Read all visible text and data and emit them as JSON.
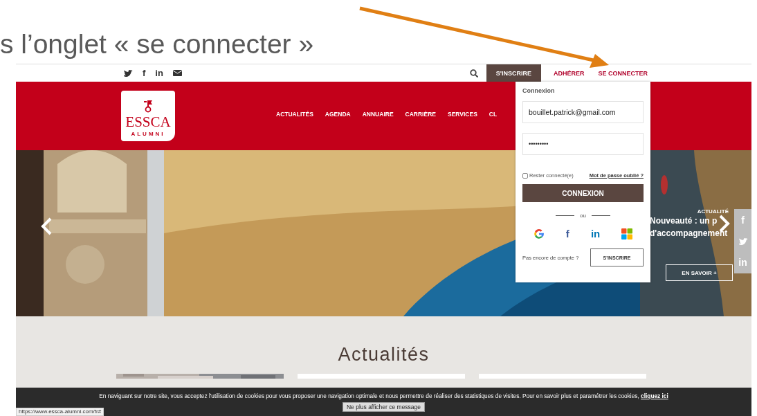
{
  "slide": {
    "caption": "s l’onglet « se connecter »"
  },
  "site": {
    "social_links": [
      {
        "kind": "twitter"
      },
      {
        "kind": "glyph",
        "glyph": "f"
      },
      {
        "kind": "glyph",
        "glyph": "in"
      },
      {
        "kind": "mail"
      }
    ],
    "top_links": [
      {
        "label": "S'INSCRIRE",
        "kind": "filled"
      },
      {
        "label": "ADHÉRER",
        "kind": "plain"
      },
      {
        "label": "SE CONNECTER",
        "kind": "plain"
      }
    ],
    "logo": {
      "name": "ESSCA",
      "subtitle": "ALUMNI"
    },
    "nav": [
      "ACTUALITÉS",
      "AGENDA",
      "ANNUAIRE",
      "CARRIÈRE",
      "SERVICES",
      "CL"
    ],
    "login": {
      "title": "Connexion",
      "email": "bouillet.patrick@gmail.com",
      "password": "•••••••••",
      "remember": {
        "label": "Rester connecté(e)",
        "checked": false
      },
      "forgot": "Mot de passe oublié ?",
      "submit": "CONNEXION",
      "separator": "ou",
      "providers": [
        {
          "kind": "google"
        },
        {
          "kind": "glyph",
          "glyph": "f",
          "color": "#3b5998"
        },
        {
          "kind": "glyph",
          "glyph": "in",
          "color": "#0077b5"
        },
        {
          "kind": "microsoft"
        }
      ],
      "signup_prompt": "Pas encore de compte ?",
      "signup_button": "S'INSCRIRE"
    },
    "hero": {
      "tag": "ACTUALITÉ",
      "headline": [
        "Nouveauté : un p",
        "d'accompagnement"
      ],
      "button": "EN SAVOIR +",
      "share": [
        {
          "kind": "glyph",
          "glyph": "f"
        },
        {
          "kind": "twitter"
        },
        {
          "kind": "glyph",
          "glyph": "in"
        }
      ]
    },
    "news": {
      "title": "Actualités"
    },
    "cookie_banner": {
      "text": "En naviguant sur notre site, vous acceptez l'utilisation de cookies pour vous proposer une navigation optimale et nous permettre de réaliser des statistiques de visites. Pour en savoir plus et paramétrer les cookies, ",
      "link": "cliquez ici",
      "button": "Ne plus afficher ce message"
    },
    "status_url": "https://www.essca-alumni.com/fr#"
  }
}
